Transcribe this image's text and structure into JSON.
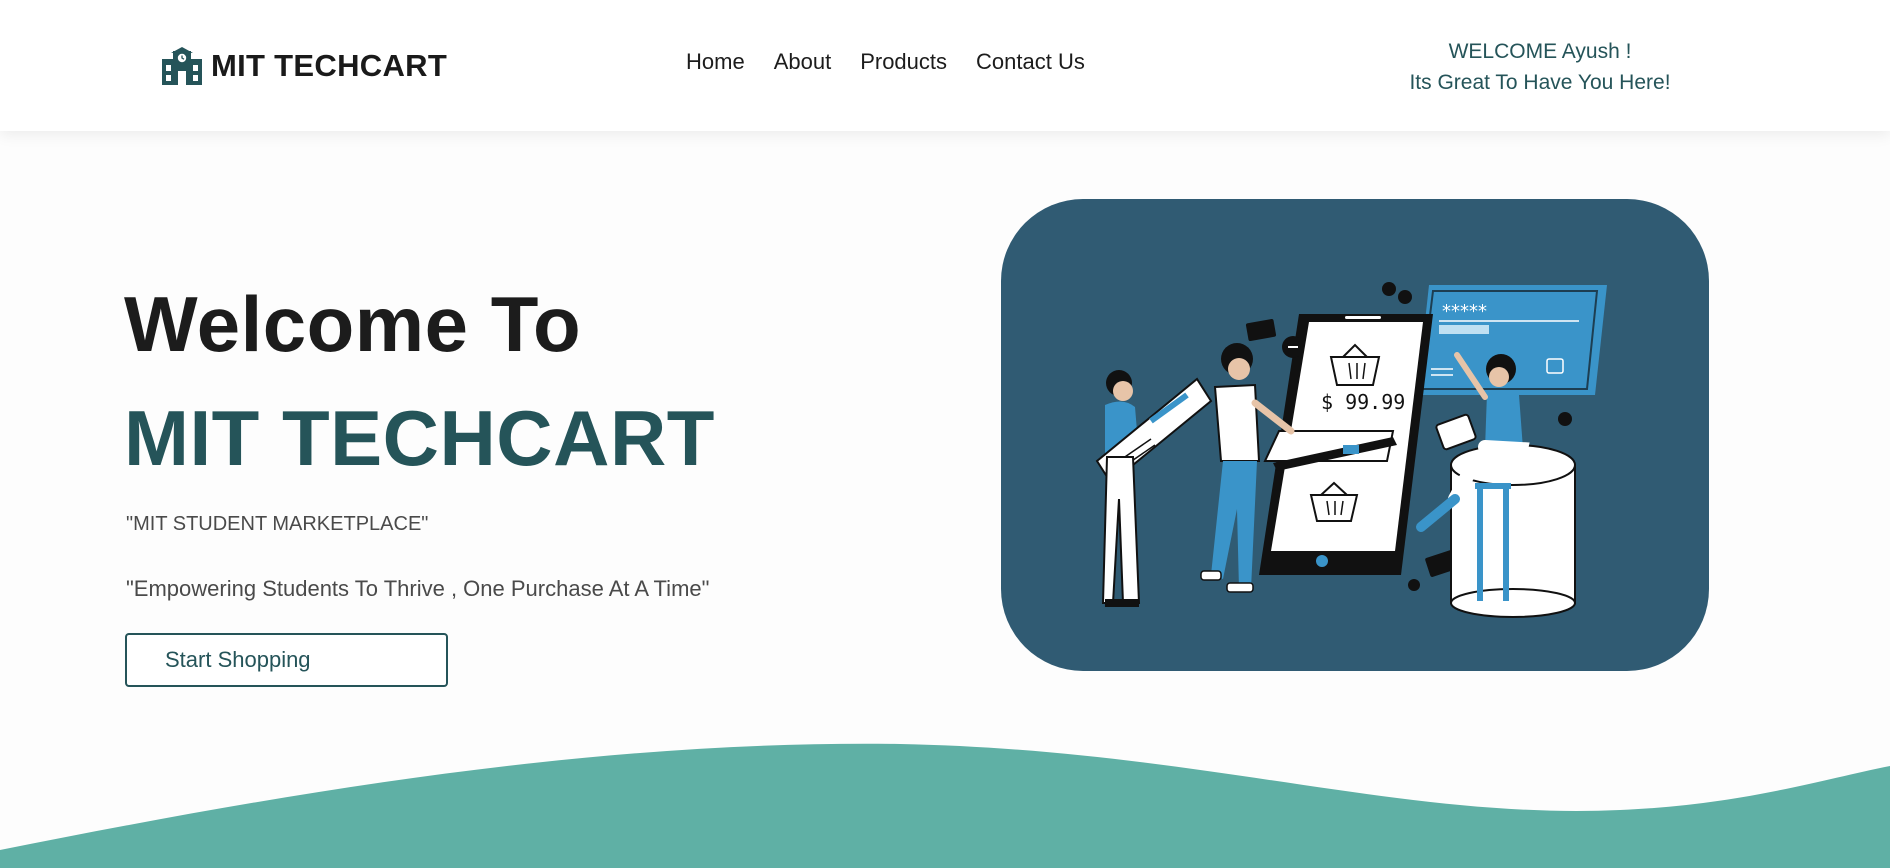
{
  "header": {
    "brand": "MIT TECHCART",
    "nav": [
      {
        "label": "Home"
      },
      {
        "label": "About"
      },
      {
        "label": "Products"
      },
      {
        "label": "Contact Us"
      }
    ],
    "welcome_line1": "WELCOME Ayush !",
    "welcome_line2": "Its Great To Have You Here!"
  },
  "hero": {
    "title_line1": "Welcome To",
    "title_line2": "MIT TECHCART",
    "tagline": "\"MIT STUDENT MARKETPLACE\"",
    "motto": "\"Empowering Students To Thrive , One Purchase At A Time\"",
    "cta_label": "Start Shopping"
  },
  "illustration": {
    "price": "$ 99.99",
    "password_mask": "*****"
  },
  "colors": {
    "brand_dark": "#255459",
    "illustration_bg": "#305b73",
    "accent_blue": "#3a94c9",
    "wave": "#5fb0a5"
  }
}
